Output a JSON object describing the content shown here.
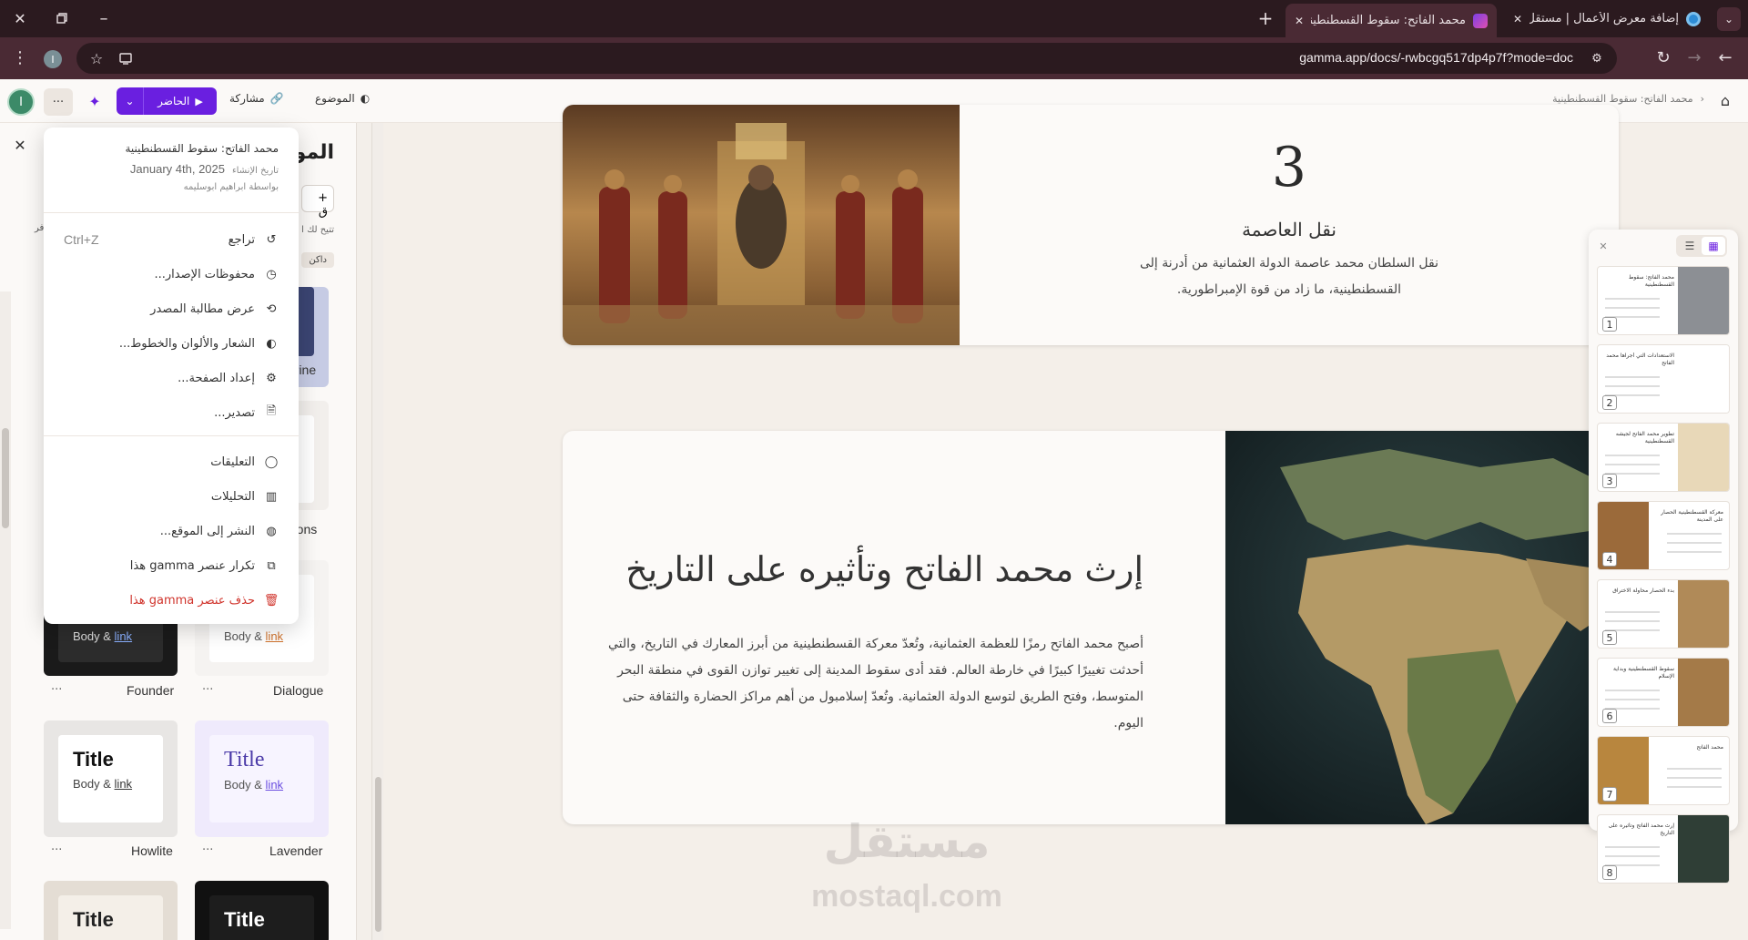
{
  "browser": {
    "tabs": [
      {
        "title": "إضافة معرض الأعمال | مستقل"
      },
      {
        "title": "محمد الفاتح: سقوط القسطنطينية"
      }
    ],
    "url": "gamma.app/docs/-rwbcgq517dp4p7f?mode=doc",
    "profile_initial": "I"
  },
  "gamma": {
    "breadcrumb": "محمد الفاتح: سقوط القسطنطينية",
    "theme_button": "الموضوع",
    "share_button": "مشاركة",
    "present_button": "الحاضر",
    "more_label": "···",
    "user_initial": "I"
  },
  "theme_panel": {
    "title": "المو",
    "new_partial": "+ ق",
    "hint_partial": "تتيح لك ا",
    "dark_tag": "داكن",
    "side_letter": "فر",
    "themes": [
      {
        "name": "arine"
      },
      {
        "name": "mons"
      },
      {
        "name": "Dialogue",
        "sample_body": "Body &",
        "sample_link": "link"
      },
      {
        "name": "Founder",
        "sample_body": "Body &",
        "sample_link": "link"
      },
      {
        "name": "Lavender",
        "sample_title": "Title",
        "sample_body": "Body &",
        "sample_link": "link"
      },
      {
        "name": "Howlite",
        "sample_title": "Title",
        "sample_body": "Body &",
        "sample_link": "link"
      },
      {
        "name": "",
        "sample_title": "Title"
      },
      {
        "name": "",
        "sample_title": "Title"
      }
    ],
    "item_dots": "···"
  },
  "menu": {
    "doc_title": "محمد الفاتح: سقوط القسطنطينية",
    "created_label": "تاريخ الإنشاء",
    "created_date": "January 4th, 2025",
    "author": "بواسطة ابراهيم ابوسليمه",
    "items": [
      {
        "label": "تراجع",
        "shortcut": "Ctrl+Z"
      },
      {
        "label": "محفوظات الإصدار..."
      },
      {
        "label": "عرض مطالبة المصدر"
      },
      {
        "label": "الشعار والألوان والخطوط..."
      },
      {
        "label": "إعداد الصفحة..."
      },
      {
        "label": "تصدير..."
      },
      {
        "label": "التعليقات"
      },
      {
        "label": "التحليلات"
      },
      {
        "label": "النشر إلى الموقع..."
      },
      {
        "label": "تكرار عنصر gamma هذا"
      },
      {
        "label": "حذف عنصر gamma هذا"
      }
    ]
  },
  "card1": {
    "number": "3",
    "heading": "نقل العاصمة",
    "body": "نقل السلطان محمد عاصمة الدولة العثمانية من أدرنة إلى القسطنطينية، ما زاد من قوة الإمبراطورية."
  },
  "card2": {
    "heading": "إرث محمد الفاتح وتأثيره على التاريخ",
    "body": "أصبح محمد الفاتح رمزًا للعظمة العثمانية، وتُعدّ معركة القسطنطينية من أبرز المعارك في التاريخ، والتي أحدثت تغييرًا كبيرًا في خارطة العالم. فقد أدى سقوط المدينة إلى تغيير توازن القوى في منطقة البحر المتوسط، وفتح الطريق لتوسع الدولة العثمانية. وتُعدّ إسلامبول من أهم مراكز الحضارة والثقافة حتى اليوم."
  },
  "thumbnails": {
    "numbers": [
      "1",
      "2",
      "3",
      "4",
      "5",
      "6",
      "7",
      "8"
    ],
    "titles": [
      "محمد الفاتح: سقوط القسطنطينية",
      "الاستعدادات التي أجراها محمد الفاتح",
      "تطوير محمد الفاتح لجيشه القسطنطينية",
      "معركة القسطنطينية الحصار على المدينة",
      "بدء الحصار محاولة الاختراق",
      "سقوط القسطنطينية وبداية الإسلام",
      "محمد الفاتح",
      "إرث محمد الفاتح وتأثيره على التاريخ"
    ]
  },
  "watermark": {
    "arabic": "مستقل",
    "latin": "mostaql.com"
  },
  "colors": {
    "chrome_dark": "#2b1a1f",
    "chrome": "#4a2a34",
    "accent": "#6a1fe0",
    "danger": "#d0342c"
  }
}
